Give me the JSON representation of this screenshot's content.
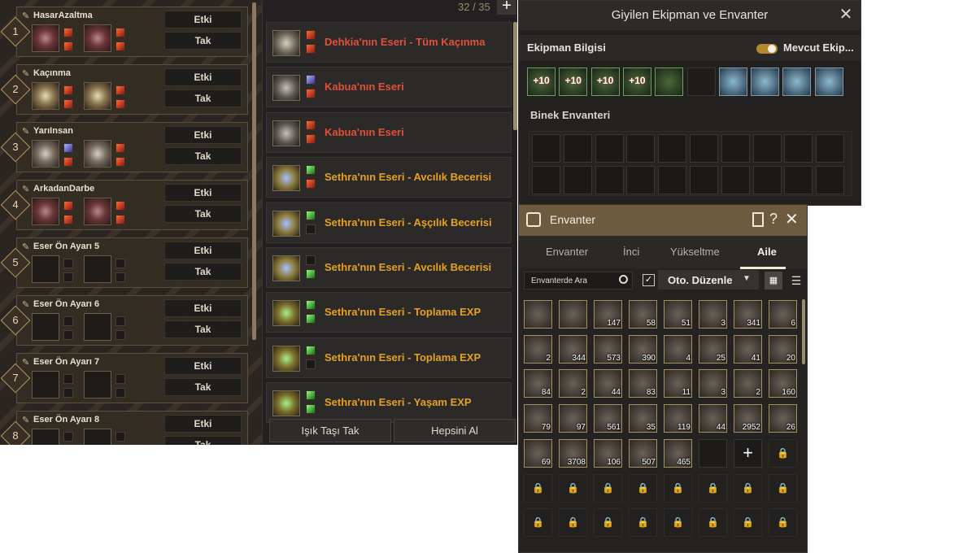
{
  "presets": [
    {
      "number": "1",
      "name": "HasarAzaltma",
      "effect_label": "Etki",
      "equip_label": "Tak",
      "slots": [
        "red",
        "red"
      ],
      "gems": [
        [
          "red",
          "red"
        ],
        [
          "red",
          "red"
        ]
      ]
    },
    {
      "number": "2",
      "name": "Kaçınma",
      "effect_label": "Etki",
      "equip_label": "Tak",
      "slots": [
        "gold",
        "gold"
      ],
      "gems": [
        [
          "red",
          "red"
        ],
        [
          "red",
          "red"
        ]
      ]
    },
    {
      "number": "3",
      "name": "YarıInsan",
      "effect_label": "Etki",
      "equip_label": "Tak",
      "slots": [
        "gray",
        "gray"
      ],
      "gems": [
        [
          "blue",
          "red"
        ],
        [
          "red",
          "red"
        ]
      ]
    },
    {
      "number": "4",
      "name": "ArkadanDarbe",
      "effect_label": "Etki",
      "equip_label": "Tak",
      "slots": [
        "red",
        "red"
      ],
      "gems": [
        [
          "red",
          "red"
        ],
        [
          "red",
          "red"
        ]
      ]
    },
    {
      "number": "5",
      "name": "Eser Ön Ayarı 5",
      "effect_label": "Etki",
      "equip_label": "Tak",
      "slots": [
        "",
        ""
      ],
      "gems": [
        [
          "empty",
          "empty"
        ],
        [
          "empty",
          "empty"
        ]
      ]
    },
    {
      "number": "6",
      "name": "Eser Ön Ayarı 6",
      "effect_label": "Etki",
      "equip_label": "Tak",
      "slots": [
        "",
        ""
      ],
      "gems": [
        [
          "empty",
          "empty"
        ],
        [
          "empty",
          "empty"
        ]
      ]
    },
    {
      "number": "7",
      "name": "Eser Ön Ayarı 7",
      "effect_label": "Etki",
      "equip_label": "Tak",
      "slots": [
        "",
        ""
      ],
      "gems": [
        [
          "empty",
          "empty"
        ],
        [
          "empty",
          "empty"
        ]
      ]
    },
    {
      "number": "8",
      "name": "Eser Ön Ayarı 8",
      "effect_label": "Etki",
      "equip_label": "Tak",
      "slots": [
        "",
        ""
      ],
      "gems": [
        [
          "empty",
          "empty"
        ],
        [
          "empty",
          "empty"
        ]
      ]
    }
  ],
  "artifacts": {
    "count": "32 / 35",
    "add_label": "+",
    "items": [
      {
        "name": "Dehkia'nın Eseri - Tüm Kaçınma",
        "color": "red",
        "icon": "rg",
        "gems": [
          "red",
          "red"
        ]
      },
      {
        "name": "Kabua'nın Eseri",
        "color": "red",
        "icon": "gy",
        "gems": [
          "blue",
          "red"
        ]
      },
      {
        "name": "Kabua'nın Eseri",
        "color": "red",
        "icon": "gy",
        "gems": [
          "red",
          "red"
        ]
      },
      {
        "name": "Sethra'nın Eseri - Avcılık Becerisi",
        "color": "gold",
        "icon": "bl",
        "gems": [
          "green",
          "red"
        ]
      },
      {
        "name": "Sethra'nın Eseri - Aşçılık Becerisi",
        "color": "gold",
        "icon": "bl",
        "gems": [
          "green",
          "empty"
        ]
      },
      {
        "name": "Sethra'nın Eseri - Avcılık Becerisi",
        "color": "gold",
        "icon": "bl",
        "gems": [
          "empty",
          "green"
        ]
      },
      {
        "name": "Sethra'nın Eseri - Toplama EXP",
        "color": "gold",
        "icon": "gr",
        "gems": [
          "green",
          "green"
        ]
      },
      {
        "name": "Sethra'nın Eseri - Toplama EXP",
        "color": "gold",
        "icon": "gr",
        "gems": [
          "green",
          "empty"
        ]
      },
      {
        "name": "Sethra'nın Eseri - Yaşam EXP",
        "color": "gold",
        "icon": "gr",
        "gems": [
          "green",
          "green"
        ]
      }
    ],
    "footer": {
      "left": "Işık Taşı Tak",
      "right": "Hepsini Al"
    }
  },
  "equipment": {
    "title": "Giyilen Ekipman ve Envanter",
    "close": "✕",
    "info_label": "Ekipman Bilgisi",
    "current_label": "Mevcut Ekip...",
    "slots": [
      {
        "upgrade": "+10",
        "style": "green"
      },
      {
        "upgrade": "+10",
        "style": "green"
      },
      {
        "upgrade": "+10",
        "style": "green"
      },
      {
        "upgrade": "+10",
        "style": "green"
      },
      {
        "upgrade": "",
        "style": "green"
      },
      {
        "upgrade": "",
        "style": "dark"
      },
      {
        "upgrade": "",
        "style": "blue"
      },
      {
        "upgrade": "",
        "style": "blue"
      },
      {
        "upgrade": "",
        "style": "blue"
      },
      {
        "upgrade": "",
        "style": "blue"
      }
    ],
    "mount_label": "Binek Envanteri"
  },
  "inventory": {
    "title": "Envanter",
    "help": "?",
    "close": "✕",
    "tabs": [
      "Envanter",
      "İnci",
      "Yükseltme",
      "Aile"
    ],
    "search_placeholder": "Envanterde Ara",
    "sort_label": "Oto. Düzenle",
    "items": [
      "",
      "",
      "147",
      "58",
      "51",
      "3",
      "341",
      "6",
      "2",
      "344",
      "573",
      "390",
      "4",
      "25",
      "41",
      "20",
      "84",
      "2",
      "44",
      "83",
      "11",
      "3",
      "2",
      "160",
      "79",
      "97",
      "561",
      "35",
      "119",
      "44",
      "2952",
      "26",
      "69",
      "3708",
      "106",
      "507",
      "465"
    ]
  }
}
